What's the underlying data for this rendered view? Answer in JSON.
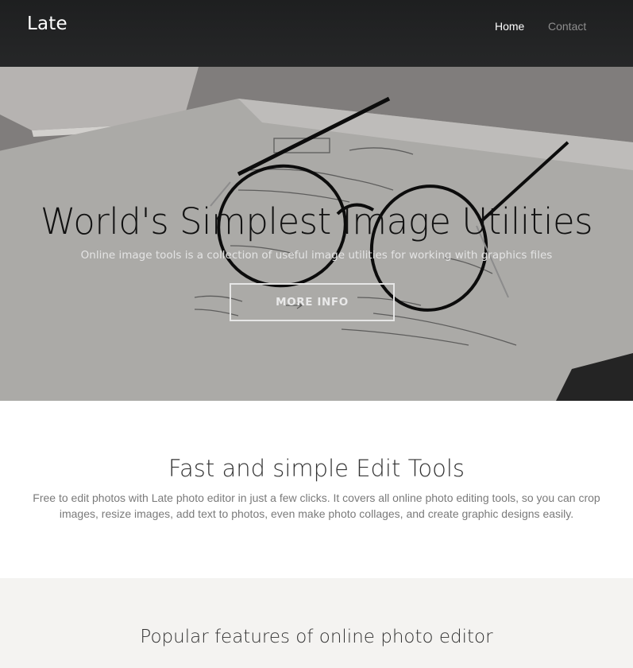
{
  "nav": {
    "brand": "Late",
    "links": [
      {
        "label": "Home",
        "active": true
      },
      {
        "label": "Contact",
        "active": false
      }
    ]
  },
  "hero": {
    "title": "World's Simplest Image Utilities",
    "subtitle": "Online image tools is a collection of useful image utilities for working with graphics files",
    "button_label": "MORE INFO",
    "background_image": "glasses-on-notebook-photo"
  },
  "tools": {
    "title": "Fast and simple Edit Tools",
    "description": "Free to edit photos with Late photo editor in just a few clicks. It covers all online photo editing tools, so you can crop images, resize images, add text to photos, even make photo collages, and create graphic designs easily."
  },
  "features": {
    "title": "Popular features of online photo editor"
  },
  "colors": {
    "nav_bg": "#222324",
    "section_alt_bg": "#f4f3f1",
    "muted_text": "#7a7a7a"
  }
}
